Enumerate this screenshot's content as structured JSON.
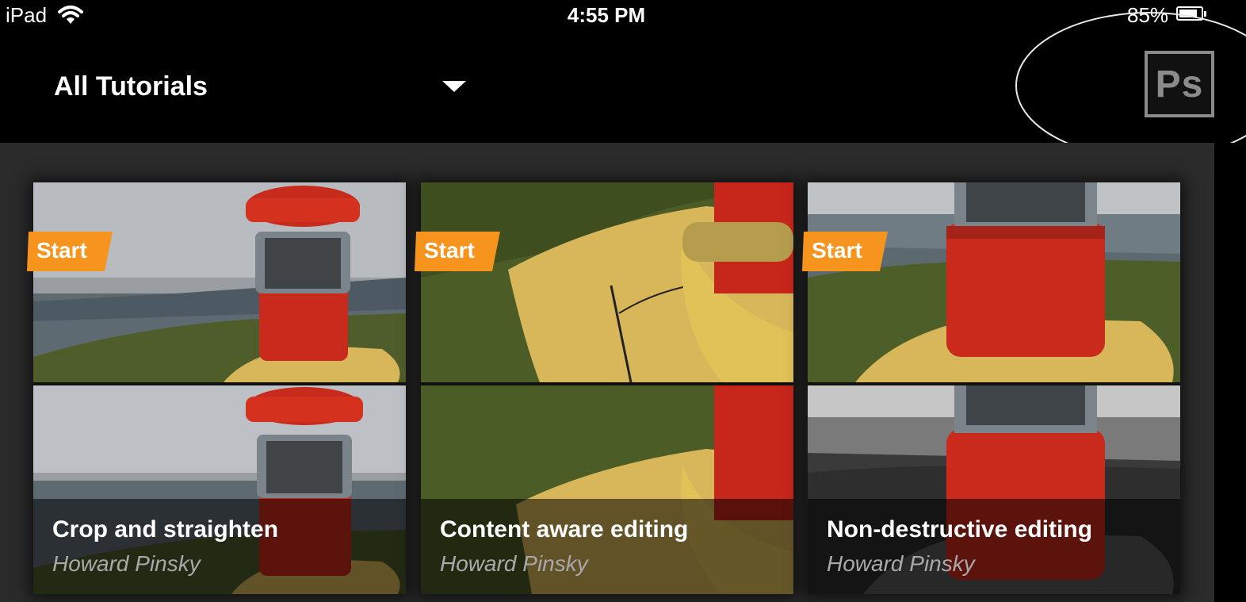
{
  "status_bar": {
    "device": "iPad",
    "time": "4:55 PM",
    "battery_percent": "85%",
    "battery_level": 0.85
  },
  "header": {
    "title": "All Tutorials",
    "app_logo_text": "Ps"
  },
  "tutorials": [
    {
      "badge": "Start",
      "title": "Crop and straighten",
      "author": "Howard Pinsky"
    },
    {
      "badge": "Start",
      "title": "Content aware editing",
      "author": "Howard Pinsky"
    },
    {
      "badge": "Start",
      "title": "Non-destructive editing",
      "author": "Howard Pinsky"
    }
  ],
  "colors": {
    "badge_orange": "#f7941d",
    "lighthouse_red": "#d42a1c",
    "rock_yellow": "#d8b65a",
    "content_bg": "#2b2b2b",
    "ps_gray": "#8b8b8b"
  }
}
